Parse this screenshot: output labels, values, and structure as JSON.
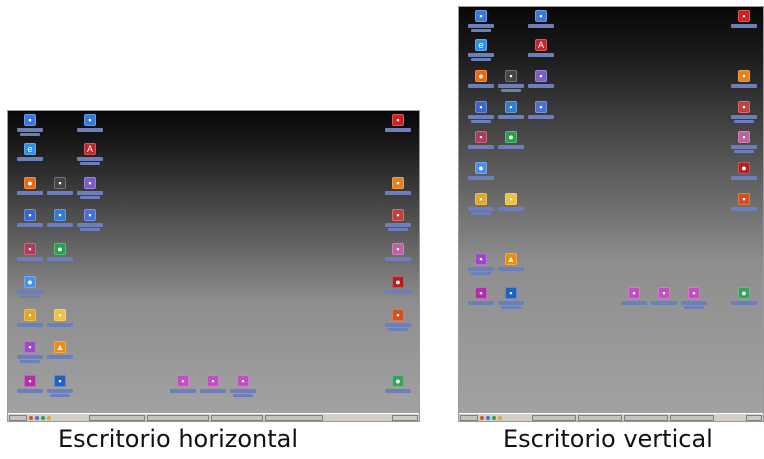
{
  "captions": {
    "horizontal": "Escritorio horizontal",
    "vertical": "Escritorio vertical"
  },
  "colors": {
    "desktop_top": "#080808",
    "desktop_bottom": "#a3a3a3",
    "taskbar": "#d4d0c8",
    "icon_label": "#6d7fb8"
  },
  "desktops": {
    "horizontal": {
      "icons": [
        {
          "name": "computer-icon",
          "color": "#3a78d8",
          "glyph": "▪"
        },
        {
          "name": "network-icon",
          "color": "#3a78d8",
          "glyph": "▪"
        },
        {
          "name": "internet-explorer-icon",
          "color": "#2f8fe6",
          "glyph": "e"
        },
        {
          "name": "acrobat-icon",
          "color": "#c0262d",
          "glyph": "A"
        },
        {
          "name": "firefox-icon",
          "color": "#e66a12",
          "glyph": "●"
        },
        {
          "name": "media-icon",
          "color": "#444444",
          "glyph": "▪"
        },
        {
          "name": "app-purple-icon",
          "color": "#7b5cc8",
          "glyph": "▪"
        },
        {
          "name": "folder-blue-icon",
          "color": "#3c66c8",
          "glyph": "▪"
        },
        {
          "name": "shield-icon",
          "color": "#2f7bd0",
          "glyph": "▪"
        },
        {
          "name": "document-icon",
          "color": "#4a6fd6",
          "glyph": "▪"
        },
        {
          "name": "app-red-icon",
          "color": "#b03a5a",
          "glyph": "▪"
        },
        {
          "name": "globe-icon",
          "color": "#2aa04a",
          "glyph": "●"
        },
        {
          "name": "app-globe-icon",
          "color": "#4a8fe0",
          "glyph": "●"
        },
        {
          "name": "folder-yellow-icon",
          "color": "#e0a82a",
          "glyph": "▪"
        },
        {
          "name": "folder-icon",
          "color": "#f0c040",
          "glyph": "▪"
        },
        {
          "name": "photo-icon",
          "color": "#9a4ac8",
          "glyph": "▪"
        },
        {
          "name": "vlc-icon",
          "color": "#f08a10",
          "glyph": "▲"
        },
        {
          "name": "app-magenta-icon",
          "color": "#b030a8",
          "glyph": "▪"
        },
        {
          "name": "app-blue-icon",
          "color": "#2060c0",
          "glyph": "▪"
        },
        {
          "name": "file-1-icon",
          "color": "#c050c0",
          "glyph": "▪"
        },
        {
          "name": "file-2-icon",
          "color": "#c050c0",
          "glyph": "▪"
        },
        {
          "name": "file-3-icon",
          "color": "#c050c0",
          "glyph": "▪"
        },
        {
          "name": "winrar-icon",
          "color": "#d02020",
          "glyph": "▪"
        },
        {
          "name": "app-orange-icon",
          "color": "#e08020",
          "glyph": "▪"
        },
        {
          "name": "app-cross-icon",
          "color": "#c04040",
          "glyph": "▪"
        },
        {
          "name": "app-pink-icon",
          "color": "#c060a0",
          "glyph": "▪"
        },
        {
          "name": "app-red-dot-icon",
          "color": "#b02020",
          "glyph": "●"
        },
        {
          "name": "app-flame-icon",
          "color": "#d05020",
          "glyph": "▪"
        },
        {
          "name": "recycle-bin-icon",
          "color": "#3aa060",
          "glyph": "●"
        }
      ],
      "taskbar_buttons": 5
    },
    "vertical": {
      "icons": [
        {
          "name": "computer-icon",
          "color": "#3a78d8",
          "glyph": "▪"
        },
        {
          "name": "network-icon",
          "color": "#3a78d8",
          "glyph": "▪"
        },
        {
          "name": "winrar-icon",
          "color": "#d02020",
          "glyph": "▪"
        },
        {
          "name": "internet-explorer-icon",
          "color": "#2f8fe6",
          "glyph": "e"
        },
        {
          "name": "acrobat-icon",
          "color": "#c0262d",
          "glyph": "A"
        },
        {
          "name": "firefox-icon",
          "color": "#e66a12",
          "glyph": "●"
        },
        {
          "name": "media-icon",
          "color": "#444444",
          "glyph": "▪"
        },
        {
          "name": "app-purple-icon",
          "color": "#7b5cc8",
          "glyph": "▪"
        },
        {
          "name": "app-orange-icon",
          "color": "#e08020",
          "glyph": "▪"
        },
        {
          "name": "folder-blue-icon",
          "color": "#3c66c8",
          "glyph": "▪"
        },
        {
          "name": "shield-icon",
          "color": "#2f7bd0",
          "glyph": "▪"
        },
        {
          "name": "document-icon",
          "color": "#4a6fd6",
          "glyph": "▪"
        },
        {
          "name": "app-cross-icon",
          "color": "#c04040",
          "glyph": "▪"
        },
        {
          "name": "app-red-icon",
          "color": "#b03a5a",
          "glyph": "▪"
        },
        {
          "name": "globe-icon",
          "color": "#2aa04a",
          "glyph": "●"
        },
        {
          "name": "app-pink-icon",
          "color": "#c060a0",
          "glyph": "▪"
        },
        {
          "name": "app-globe-icon",
          "color": "#4a8fe0",
          "glyph": "●"
        },
        {
          "name": "app-red-dot-icon",
          "color": "#b02020",
          "glyph": "●"
        },
        {
          "name": "folder-yellow-icon",
          "color": "#e0a82a",
          "glyph": "▪"
        },
        {
          "name": "folder-icon",
          "color": "#f0c040",
          "glyph": "▪"
        },
        {
          "name": "app-flame-icon",
          "color": "#d05020",
          "glyph": "▪"
        },
        {
          "name": "photo-icon",
          "color": "#9a4ac8",
          "glyph": "▪"
        },
        {
          "name": "vlc-icon",
          "color": "#f08a10",
          "glyph": "▲"
        },
        {
          "name": "app-magenta-icon",
          "color": "#b030a8",
          "glyph": "▪"
        },
        {
          "name": "app-blue-icon",
          "color": "#2060c0",
          "glyph": "▪"
        },
        {
          "name": "file-1-icon",
          "color": "#c050c0",
          "glyph": "▪"
        },
        {
          "name": "file-2-icon",
          "color": "#c050c0",
          "glyph": "▪"
        },
        {
          "name": "file-3-icon",
          "color": "#c050c0",
          "glyph": "▪"
        },
        {
          "name": "recycle-bin-icon",
          "color": "#3aa060",
          "glyph": "●"
        }
      ],
      "taskbar_buttons": 4
    }
  }
}
